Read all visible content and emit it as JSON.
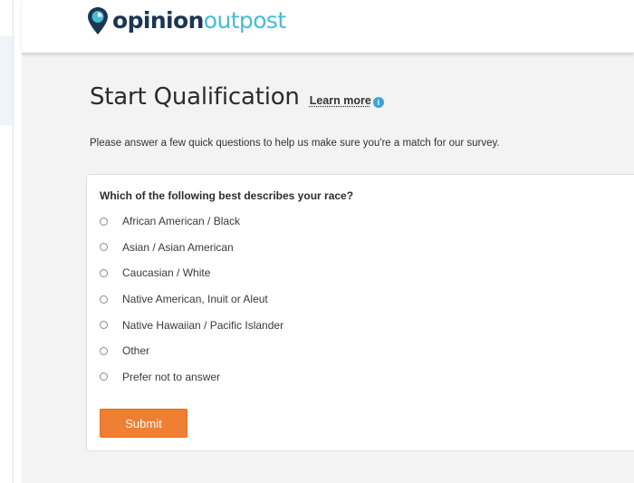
{
  "colors": {
    "brand_navy": "#1b3552",
    "brand_teal": "#45bdd3",
    "accent_orange": "#ef7f33",
    "info_blue": "#3aa4db",
    "content_bg": "#f3f3f3"
  },
  "header": {
    "logo": {
      "icon": "map-pin-icon",
      "bold_text": "opinion",
      "light_text": "outpost"
    }
  },
  "main": {
    "title": "Start Qualification",
    "learn_more": "Learn more",
    "info_icon": "info-icon",
    "info_glyph": "i",
    "intro": "Please answer a few quick questions to help us make sure you're a match for our survey."
  },
  "question": {
    "text": "Which of the following best describes your race?",
    "options": [
      {
        "label": "African American / Black",
        "selected": false
      },
      {
        "label": "Asian / Asian American",
        "selected": false
      },
      {
        "label": "Caucasian / White",
        "selected": false
      },
      {
        "label": "Native American, Inuit or Aleut",
        "selected": false
      },
      {
        "label": "Native Hawaiian / Pacific Islander",
        "selected": false
      },
      {
        "label": "Other",
        "selected": false
      },
      {
        "label": "Prefer not to answer",
        "selected": false
      }
    ]
  },
  "actions": {
    "submit_label": "Submit"
  }
}
